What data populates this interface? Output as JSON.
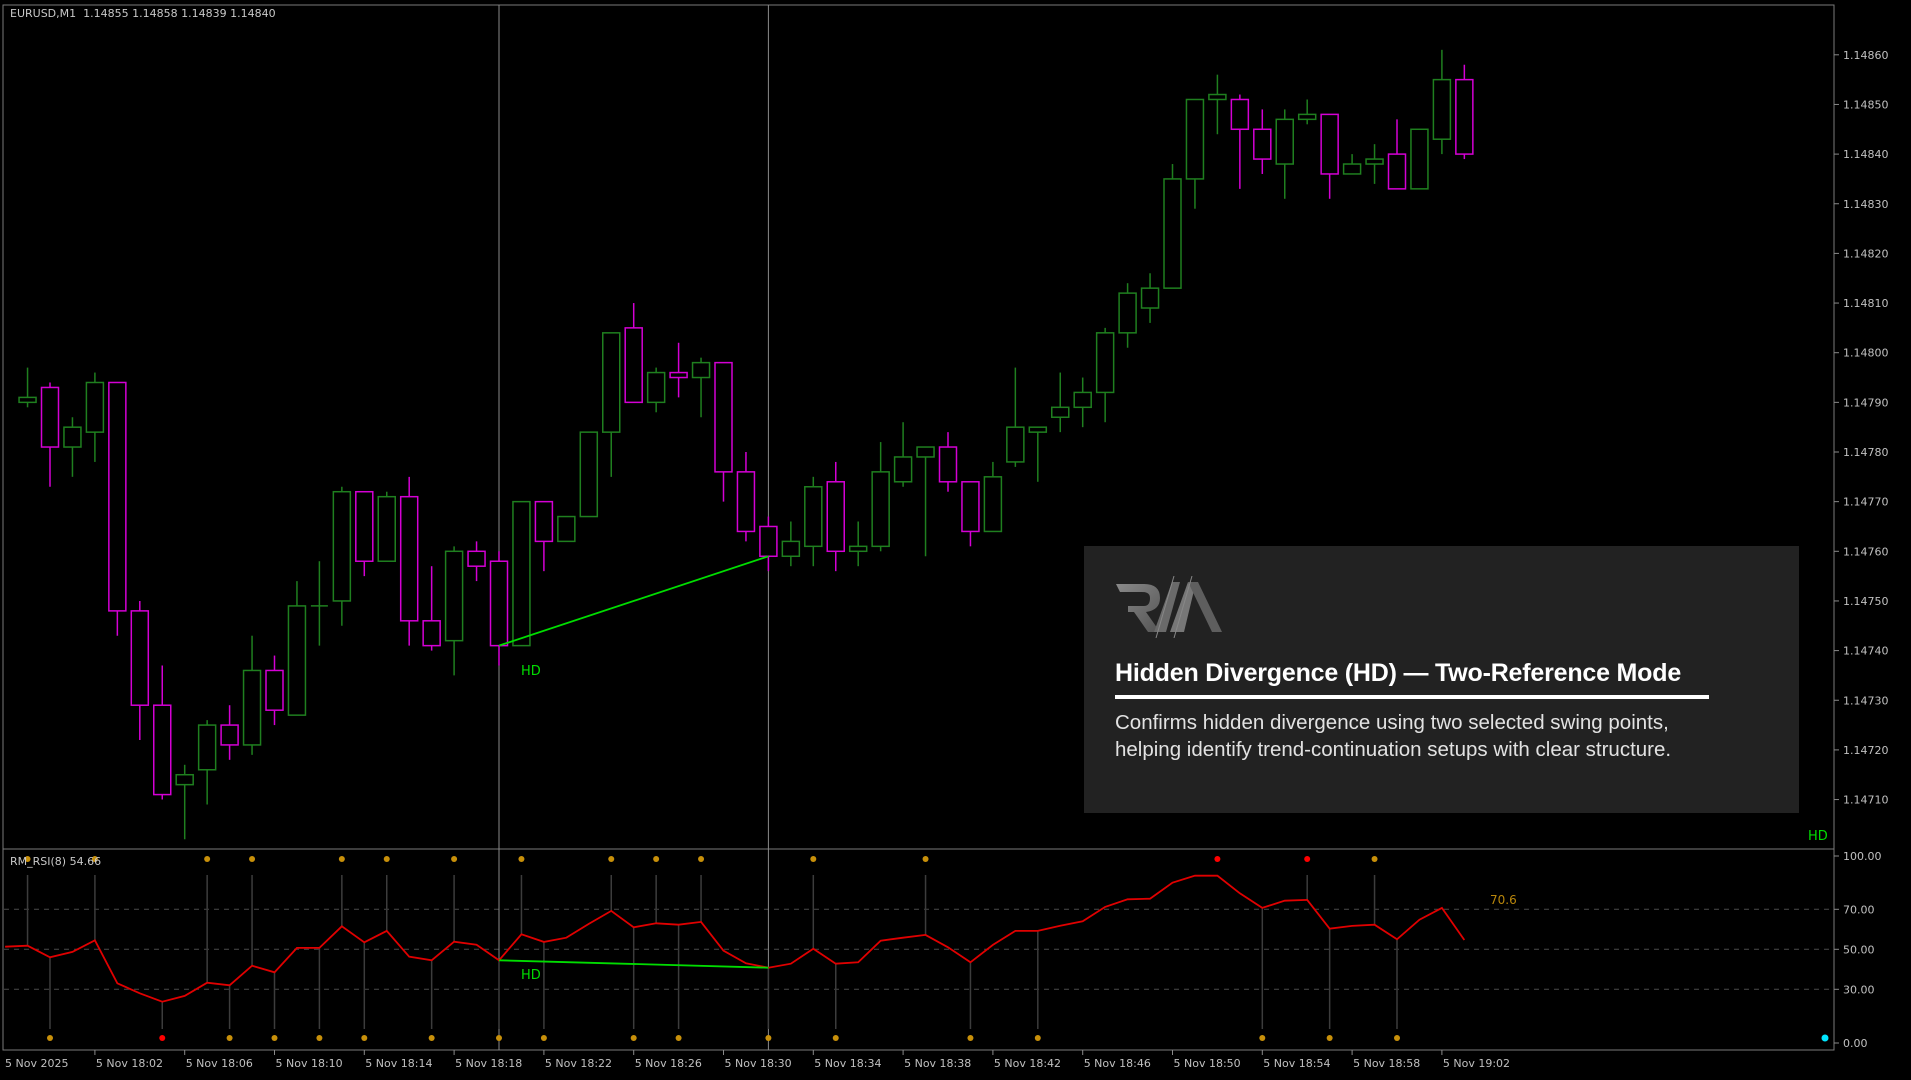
{
  "header": {
    "symbol_timeframe": "EURUSD,M1",
    "ohlc": "1.14855 1.14858 1.14839 1.14840"
  },
  "indicator": {
    "label": "RM_RSI(8) 54.66",
    "level_label": "70.6",
    "hd_label": "HD",
    "corner_label": "HD"
  },
  "price_chart_hd_label": "HD",
  "info_panel": {
    "logo_text": "RM",
    "title": "Hidden Divergence (HD) — Two-Reference Mode",
    "desc_line1": "Confirms hidden divergence using two selected swing points,",
    "desc_line2": "helping identify trend-continuation setups with clear structure."
  },
  "colors": {
    "bull": "#1f7f1f",
    "bear": "#d400d4",
    "rsi": "#e00000",
    "divergence": "#00dd00",
    "pivot": "#c8900a",
    "pivot_extreme": "#ff0000",
    "status_dot": "#00e5ff"
  },
  "chart_data": [
    {
      "type": "candlestick",
      "symbol": "EURUSD",
      "timeframe": "M1",
      "price_axis_ticks": [
        "1.14860",
        "1.14850",
        "1.14840",
        "1.14830",
        "1.14820",
        "1.14810",
        "1.14800",
        "1.14790",
        "1.14780",
        "1.14770",
        "1.14760",
        "1.14750",
        "1.14740",
        "1.14730",
        "1.14720",
        "1.14710"
      ],
      "ylim": [
        1.147,
        1.14862
      ],
      "time_axis_ticks": [
        "5 Nov 2025",
        "5 Nov 18:02",
        "5 Nov 18:06",
        "5 Nov 18:10",
        "5 Nov 18:14",
        "5 Nov 18:18",
        "5 Nov 18:22",
        "5 Nov 18:26",
        "5 Nov 18:30",
        "5 Nov 18:34",
        "5 Nov 18:38",
        "5 Nov 18:42",
        "5 Nov 18:46",
        "5 Nov 18:50",
        "5 Nov 18:54",
        "5 Nov 18:58",
        "5 Nov 19:02"
      ],
      "columns": [
        "time",
        "open",
        "high",
        "low",
        "close"
      ],
      "candles": [
        [
          "17:59",
          1.1479,
          1.14797,
          1.14789,
          1.14791
        ],
        [
          "18:00",
          1.14793,
          1.14794,
          1.14773,
          1.14781
        ],
        [
          "18:01",
          1.14781,
          1.14787,
          1.14775,
          1.14785
        ],
        [
          "18:02",
          1.14784,
          1.14796,
          1.14778,
          1.14794
        ],
        [
          "18:03",
          1.14794,
          1.14794,
          1.14743,
          1.14748
        ],
        [
          "18:04",
          1.14748,
          1.1475,
          1.14722,
          1.14729
        ],
        [
          "18:05",
          1.14729,
          1.14737,
          1.1471,
          1.14711
        ],
        [
          "18:06",
          1.14713,
          1.14717,
          1.14702,
          1.14715
        ],
        [
          "18:07",
          1.14716,
          1.14726,
          1.14709,
          1.14725
        ],
        [
          "18:08",
          1.14725,
          1.14729,
          1.14718,
          1.14721
        ],
        [
          "18:09",
          1.14721,
          1.14743,
          1.14719,
          1.14736
        ],
        [
          "18:10",
          1.14736,
          1.14739,
          1.14725,
          1.14728
        ],
        [
          "18:11",
          1.14727,
          1.14754,
          1.14727,
          1.14749
        ],
        [
          "18:12",
          1.14749,
          1.14758,
          1.14741,
          1.14749
        ],
        [
          "18:13",
          1.1475,
          1.14773,
          1.14745,
          1.14772
        ],
        [
          "18:14",
          1.14772,
          1.14772,
          1.14755,
          1.14758
        ],
        [
          "18:15",
          1.14758,
          1.14772,
          1.14758,
          1.14771
        ],
        [
          "18:16",
          1.14771,
          1.14775,
          1.14741,
          1.14746
        ],
        [
          "18:17",
          1.14746,
          1.14757,
          1.1474,
          1.14741
        ],
        [
          "18:18",
          1.14742,
          1.14761,
          1.14735,
          1.1476
        ],
        [
          "18:19",
          1.1476,
          1.14762,
          1.14754,
          1.14757
        ],
        [
          "18:20",
          1.14758,
          1.1476,
          1.14737,
          1.14741
        ],
        [
          "18:21",
          1.14741,
          1.1477,
          1.14741,
          1.1477
        ],
        [
          "18:22",
          1.1477,
          1.1477,
          1.14756,
          1.14762
        ],
        [
          "18:23",
          1.14762,
          1.14767,
          1.14762,
          1.14767
        ],
        [
          "18:24",
          1.14767,
          1.14784,
          1.14767,
          1.14784
        ],
        [
          "18:25",
          1.14784,
          1.14804,
          1.14775,
          1.14804
        ],
        [
          "18:26",
          1.14805,
          1.1481,
          1.1479,
          1.1479
        ],
        [
          "18:27",
          1.1479,
          1.14797,
          1.14788,
          1.14796
        ],
        [
          "18:28",
          1.14796,
          1.14802,
          1.14791,
          1.14795
        ],
        [
          "18:29",
          1.14795,
          1.14799,
          1.14787,
          1.14798
        ],
        [
          "18:30",
          1.14798,
          1.14798,
          1.1477,
          1.14776
        ],
        [
          "18:31",
          1.14776,
          1.1478,
          1.14762,
          1.14764
        ],
        [
          "18:32",
          1.14765,
          1.14767,
          1.14756,
          1.14759
        ],
        [
          "18:33",
          1.14759,
          1.14766,
          1.14757,
          1.14762
        ],
        [
          "18:34",
          1.14761,
          1.14775,
          1.14757,
          1.14773
        ],
        [
          "18:35",
          1.14774,
          1.14778,
          1.14756,
          1.1476
        ],
        [
          "18:36",
          1.1476,
          1.14766,
          1.14757,
          1.14761
        ],
        [
          "18:37",
          1.14761,
          1.14782,
          1.1476,
          1.14776
        ],
        [
          "18:38",
          1.14774,
          1.14786,
          1.14773,
          1.14779
        ],
        [
          "18:39",
          1.14779,
          1.14781,
          1.14759,
          1.14781
        ],
        [
          "18:40",
          1.14781,
          1.14784,
          1.14772,
          1.14774
        ],
        [
          "18:41",
          1.14774,
          1.14774,
          1.14761,
          1.14764
        ],
        [
          "18:42",
          1.14764,
          1.14778,
          1.14764,
          1.14775
        ],
        [
          "18:43",
          1.14778,
          1.14797,
          1.14777,
          1.14785
        ],
        [
          "18:44",
          1.14784,
          1.14785,
          1.14774,
          1.14785
        ],
        [
          "18:45",
          1.14787,
          1.14796,
          1.14784,
          1.14789
        ],
        [
          "18:46",
          1.14789,
          1.14795,
          1.14785,
          1.14792
        ],
        [
          "18:47",
          1.14792,
          1.14805,
          1.14786,
          1.14804
        ],
        [
          "18:48",
          1.14804,
          1.14814,
          1.14801,
          1.14812
        ],
        [
          "18:49",
          1.14809,
          1.14816,
          1.14806,
          1.14813
        ],
        [
          "18:50",
          1.14813,
          1.14838,
          1.14813,
          1.14835
        ],
        [
          "18:51",
          1.14835,
          1.14851,
          1.14829,
          1.14851
        ],
        [
          "18:52",
          1.14851,
          1.14856,
          1.14844,
          1.14852
        ],
        [
          "18:53",
          1.14851,
          1.14852,
          1.14833,
          1.14845
        ],
        [
          "18:54",
          1.14845,
          1.14849,
          1.14836,
          1.14839
        ],
        [
          "18:55",
          1.14838,
          1.14849,
          1.14831,
          1.14847
        ],
        [
          "18:56",
          1.14847,
          1.14851,
          1.14846,
          1.14848
        ],
        [
          "18:57",
          1.14848,
          1.14848,
          1.14831,
          1.14836
        ],
        [
          "18:58",
          1.14836,
          1.1484,
          1.14836,
          1.14838
        ],
        [
          "18:59",
          1.14838,
          1.14842,
          1.14834,
          1.14839
        ],
        [
          "19:00",
          1.1484,
          1.14847,
          1.14833,
          1.14833
        ],
        [
          "19:01",
          1.14833,
          1.14845,
          1.14833,
          1.14845
        ],
        [
          "19:02",
          1.14843,
          1.14861,
          1.1484,
          1.14855
        ],
        [
          "19:03",
          1.14855,
          1.14858,
          1.14839,
          1.1484
        ]
      ],
      "reference_lines": [
        "18:20",
        "18:32"
      ],
      "divergence_line": {
        "label": "HD",
        "from": [
          "18:20",
          1.14741
        ],
        "to": [
          "18:32",
          1.14759
        ]
      }
    },
    {
      "type": "line",
      "name": "RM_RSI(8)",
      "ylim": [
        0,
        100
      ],
      "axis_ticks": [
        "100.00",
        "70.00",
        "50.00",
        "30.00",
        "0.00"
      ],
      "levels": [
        70,
        50,
        30
      ],
      "start_time": "17:58",
      "values": [
        51.3,
        51.8,
        46,
        48.7,
        54.5,
        33,
        28,
        23.8,
        26.7,
        33.3,
        32,
        41.8,
        38.5,
        50.7,
        50.7,
        61.5,
        53.5,
        59.2,
        46.3,
        44.5,
        53.8,
        52.3,
        44.5,
        57.5,
        53.7,
        55.8,
        62.7,
        69.2,
        61,
        63,
        62.3,
        63.7,
        49.3,
        43,
        40.8,
        42.8,
        50.3,
        42.8,
        43.5,
        54.3,
        55.8,
        57.2,
        51,
        43.5,
        52.2,
        59.2,
        59.2,
        61.8,
        64,
        71.2,
        75,
        75.3,
        83.3,
        86.8,
        86.8,
        78,
        70.7,
        74.3,
        74.7,
        60.3,
        61.7,
        62.3,
        55,
        64.8,
        70.7,
        54.66
      ],
      "pivot_highs": [
        "17:59",
        "18:02",
        "18:07",
        "18:09",
        "18:13",
        "18:15",
        "18:18",
        "18:21",
        "18:25",
        "18:27",
        "18:29",
        "18:34",
        "18:39",
        "18:52",
        "18:56",
        "18:59"
      ],
      "pivot_highs_extreme": [
        "18:52",
        "18:56"
      ],
      "pivot_lows": [
        "18:00",
        "18:05",
        "18:08",
        "18:10",
        "18:12",
        "18:14",
        "18:17",
        "18:20",
        "18:22",
        "18:26",
        "18:28",
        "18:32",
        "18:35",
        "18:41",
        "18:44",
        "18:54",
        "18:57",
        "19:00"
      ],
      "pivot_lows_extreme": [
        "18:05"
      ],
      "divergence_line": {
        "label": "HD",
        "from": [
          "18:20",
          44.5
        ],
        "to": [
          "18:32",
          40.8
        ]
      }
    }
  ]
}
